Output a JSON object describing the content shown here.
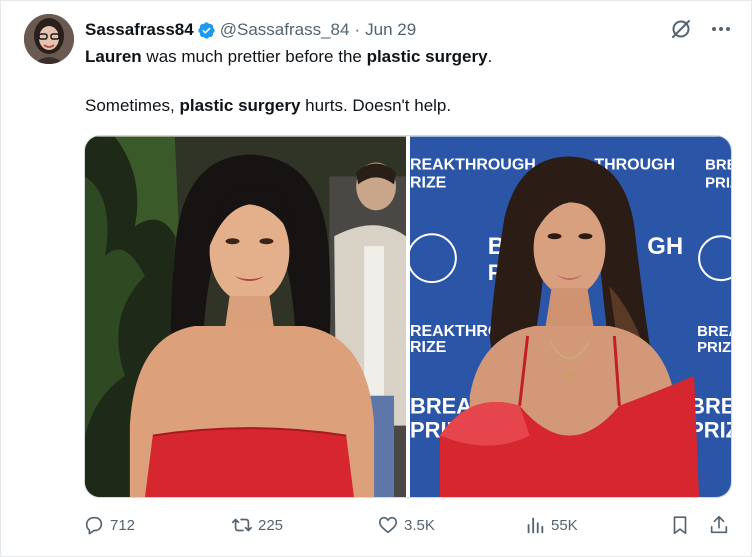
{
  "tweet": {
    "display_name": "Sassafrass84",
    "handle": "@Sassafrass_84",
    "separator": "·",
    "date": "Jun 29",
    "line1": {
      "seg1": "Lauren",
      "seg2": " was much prettier before the ",
      "seg3": "plastic surgery",
      "seg4": "."
    },
    "line2": {
      "seg1": "Sometimes, ",
      "seg2": "plastic surgery",
      "seg3": " hurts. Doesn't help."
    }
  },
  "media": {
    "left_image": "woman-red-strapless-dress-photo",
    "right_image": "woman-red-dress-breakthrough-prize-photo",
    "backdrop_text": {
      "a": "REAKTHROUGH",
      "b": "RIZE",
      "c": "THROUGH",
      "d": "BRE",
      "e": "PRIZ",
      "f": "B",
      "g": "GH",
      "h": "P",
      "i": "REAKTHRO",
      "j": "BREA",
      "k": "PRIZE",
      "l": "BRE",
      "m": "PRIZ"
    }
  },
  "actions": {
    "replies": "712",
    "reposts": "225",
    "likes": "3.5K",
    "views": "55K"
  },
  "colors": {
    "text": "#0f1419",
    "secondary": "#536471",
    "verified": "#1d9bf0",
    "dress": "#d6262f",
    "backdrop": "#2b55a6"
  }
}
